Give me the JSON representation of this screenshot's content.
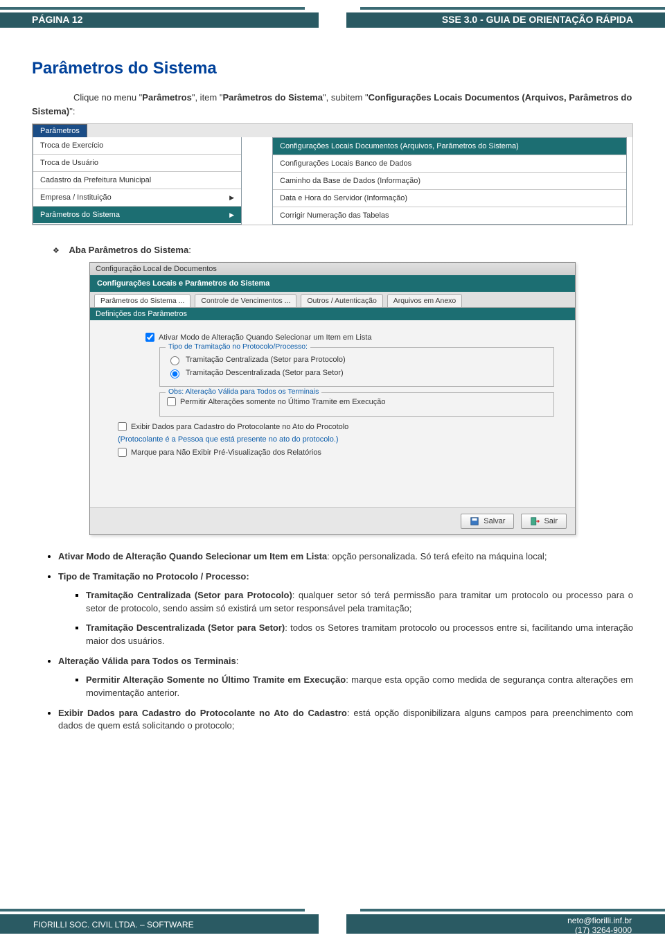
{
  "header": {
    "page_label": "PÁGINA 12",
    "title_right": "SSE 3.0 - GUIA DE ORIENTAÇÃO RÁPIDA"
  },
  "section": {
    "title": "Parâmetros do Sistema",
    "lead_prefix": "Clique no menu \"",
    "lead_m1": "Parâmetros",
    "lead_mid1": "\", item \"",
    "lead_m2": "Parâmetros do Sistema",
    "lead_mid2": "\", subitem \"",
    "lead_m3": "Configurações Locais Documentos (Arquivos, Parâmetros do Sistema)",
    "lead_suffix": "\":"
  },
  "menu": {
    "tab": "Parâmetros",
    "left": [
      {
        "label": "Troca de Exercício",
        "arrow": false
      },
      {
        "label": "Troca de Usuário",
        "arrow": false
      },
      {
        "label": "Cadastro da Prefeitura Municipal",
        "arrow": false
      },
      {
        "label": "Empresa / Instituição",
        "arrow": true
      },
      {
        "label": "Parâmetros do Sistema",
        "arrow": true,
        "selected": true
      }
    ],
    "right": [
      {
        "label": "Configurações Locais Documentos (Arquivos, Parâmetros do Sistema)",
        "highlight": true
      },
      {
        "label": "Configurações Locais Banco de Dados"
      },
      {
        "label": "Caminho da Base de Dados (Informação)"
      },
      {
        "label": "Data e Hora do Servidor (Informação)"
      },
      {
        "label": "Corrigir Numeração das Tabelas"
      }
    ]
  },
  "aba_heading": "Aba Parâmetros do Sistema:",
  "dialog": {
    "title": "Configuração Local de Documentos",
    "greenbar": "Configurações Locais e Parâmetros do Sistema",
    "tabs": [
      "Parâmetros do Sistema ...",
      "Controle de Vencimentos ...",
      "Outros / Autenticação",
      "Arquivos em Anexo"
    ],
    "subhead": "Definições dos Parâmetros",
    "chk1": "Ativar Modo de Alteração Quando Selecionar um Item em Lista",
    "group1": {
      "legend": "Tipo de Tramitação no Protocolo/Processo:",
      "r1": "Tramitação Centralizada (Setor para Protocolo)",
      "r2": "Tramitação Descentralizada (Setor para Setor)"
    },
    "group2": {
      "legend": "Obs: Alteração Válida para Todos os Terminais",
      "c1": "Permitir Alterações somente no Último Tramite em Execução"
    },
    "chk2": "Exibir Dados para Cadastro do Protocolante no Ato do Procotolo",
    "note_blue": "(Protocolante é a Pessoa que está presente no ato do protocolo.)",
    "chk3": "Marque para Não Exibir Pré-Visualização dos Relatórios",
    "btn_save": "Salvar",
    "btn_exit": "Sair"
  },
  "bullets": {
    "b1_strong": "Ativar Modo de Alteração Quando Selecionar um Item em Lista",
    "b1_rest": ": opção personalizada. Só terá efeito na máquina local;",
    "b2_strong": "Tipo de Tramitação no Protocolo / Processo:",
    "b2a_strong": "Tramitação Centralizada (Setor para Protocolo)",
    "b2a_rest": ": qualquer setor só terá permissão para tramitar um protocolo ou processo para o setor de protocolo, sendo assim só existirá um setor responsável pela tramitação;",
    "b2b_strong": "Tramitação Descentralizada (Setor para Setor)",
    "b2b_rest": ": todos os Setores tramitam protocolo ou processos entre si, facilitando uma interação maior dos usuários.",
    "b3_strong": "Alteração Válida para Todos os Terminais",
    "b3_rest": ":",
    "b3a_strong": "Permitir Alteração Somente no Último Tramite em Execução",
    "b3a_rest": ": marque esta opção como medida de segurança contra alterações em movimentação anterior.",
    "b4_strong": "Exibir Dados para Cadastro do Protocolante no Ato do Cadastro",
    "b4_rest": ": está opção disponibilizara alguns campos para preenchimento com dados de quem está solicitando o protocolo;"
  },
  "footer": {
    "left": "FIORILLI SOC. CIVIL LTDA. – SOFTWARE",
    "email": "neto@fiorilli.inf.br",
    "phone": "(17) 3264-9000"
  }
}
